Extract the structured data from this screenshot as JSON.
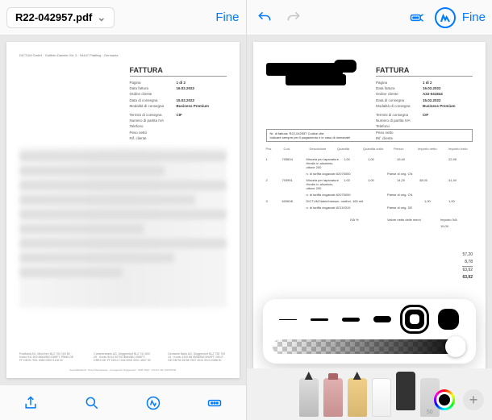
{
  "left": {
    "filename": "R22-042957.pdf",
    "done": "Fine",
    "invoice": {
      "title": "FATTURA",
      "rows": [
        {
          "k": "Pagina",
          "v": "1   di   2"
        },
        {
          "k": "Data fattura",
          "v": "16.02.2022"
        },
        {
          "k": "Ordine cliente",
          "v": ""
        },
        {
          "k": "Data di consegna",
          "v": "15.02.2022"
        },
        {
          "k": "Modalità di consegna",
          "v": "Business Premium"
        },
        {
          "k": "Termini di consegna",
          "v": "CIF"
        },
        {
          "k": "Numero di partita IVA",
          "v": ""
        },
        {
          "k": "Telefono",
          "v": ""
        },
        {
          "k": "Peso netto",
          "v": ""
        },
        {
          "k": "Rif. cliente",
          "v": ""
        }
      ]
    },
    "header_line": "DICTUM GmbH · Gottlieb-Daimler-Str. 3 · 94447 Plattling · Germania",
    "footer_cols": [
      "Postbank AG, München\nBLZ 700 100 80 · Konto 911 803\nIBAN/BIC/SWIFT: PBNK DE FF\nDE25 7001 0080 0000 9118 03",
      "Commerzbank AG, Deggendorf\nBLZ 741 800 09 · Konto 9014 50700\nIBAN/BIC/SWIFT: DRES DE FF\nDE10 7418 0009 0901 4507 00",
      "Deutsche Bank AG, Deggendorf\nBLZ 750 700 24 · Konto 1320 88\nIBAN/BIC/SWIFT: DEUT DE DB750\nDE98 7507 0024 0013 2088 00"
    ],
    "footer_line": "Geschäftsführer: Petra Steinbeisser · Amtsgericht Deggendorf · HRB 1926 · USt-ID: DE 131637544"
  },
  "right": {
    "done": "Fine",
    "invoice": {
      "title": "FATTURA",
      "rows": [
        {
          "k": "Pagina",
          "v": "1   di   2"
        },
        {
          "k": "Data fattura",
          "v": "16.02.2022"
        },
        {
          "k": "Ordine cliente",
          "v": "A22-041844"
        },
        {
          "k": "Data di consegna",
          "v": "15.02.2022"
        },
        {
          "k": "Modalità di consegna",
          "v": "Business Premium"
        },
        {
          "k": "Termini di consegna",
          "v": "CIF"
        },
        {
          "k": "Numero di partita IVA",
          "v": ""
        },
        {
          "k": "Telefono",
          "v": ""
        },
        {
          "k": "Peso netto",
          "v": ""
        },
        {
          "k": "Rif. cliente",
          "v": ""
        }
      ]
    },
    "ref_box": {
      "l1": "Nr. di fattura:   R22-042957      Codice clie:",
      "l2": "Indicare sempre per il pagamento e in caso di domande!"
    },
    "table_headers": [
      "Pos",
      "Cod.",
      "Descrizione",
      "Quantità",
      "Quantità ordin.",
      "Prezzo",
      "Importo netto",
      "Importo lordo"
    ],
    "table_rows": [
      {
        "pos": "1",
        "cod": "705804",
        "desc": "Miscela per lapanature Herdin in alluminio, ottone 200",
        "q1": "1,00",
        "q2": "1,00",
        "u": "STCK",
        "p": "19,40",
        "n": "",
        "g": "22,95"
      },
      {
        "pos": "",
        "cod": "",
        "desc": "n. di tariffa doganale 82075050",
        "q1": "",
        "q2": "",
        "u": "Paese di orig. CN",
        "p": "",
        "n": "",
        "g": ""
      },
      {
        "pos": "2",
        "cod": "703951",
        "desc": "Miscela per lapanature Herdin in alluminio, ottone 200",
        "q1": "1,00",
        "q2": "1,00",
        "u": "STCK",
        "p": "14,20",
        "n": "38,00",
        "g": "41,40"
      },
      {
        "pos": "",
        "cod": "",
        "desc": "n. di tariffa doganale 82075050",
        "q1": "",
        "q2": "",
        "u": "Paese di orig. CN",
        "p": "",
        "n": "",
        "g": ""
      },
      {
        "pos": "3",
        "cod": "600608",
        "desc": "DICTUM Nakiri/messer, rostfrei, 165 mit",
        "q1": "1,00",
        "q2": "1,00",
        "u": "STCK",
        "p": "",
        "n": "",
        "g": ""
      },
      {
        "pos": "",
        "cod": "",
        "desc": "n. di tariffa doganale 82119310",
        "q1": "",
        "q2": "",
        "u": "Paese di orig. DE",
        "p": "",
        "n": "",
        "g": ""
      }
    ],
    "totals": [
      {
        "k": "IVA %",
        "v": "19,00"
      },
      {
        "k": "Valore netto delle merci",
        "v": ""
      },
      {
        "k": "Importo IVA",
        "v": ""
      }
    ],
    "grand": [
      {
        "k": "",
        "v": "57,20"
      },
      {
        "k": "",
        "v": "8,78"
      },
      {
        "k": "",
        "v": "63,92"
      },
      {
        "k": "",
        "v": "63,92"
      }
    ],
    "ruler_num": "50"
  },
  "colors": {
    "accent": "#007aff"
  }
}
